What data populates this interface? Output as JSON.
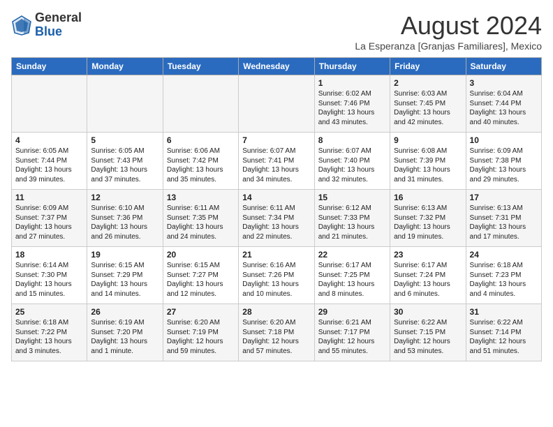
{
  "logo": {
    "line1": "General",
    "line2": "Blue"
  },
  "title": "August 2024",
  "location": "La Esperanza [Granjas Familiares], Mexico",
  "days_header": [
    "Sunday",
    "Monday",
    "Tuesday",
    "Wednesday",
    "Thursday",
    "Friday",
    "Saturday"
  ],
  "weeks": [
    [
      {
        "day": "",
        "content": ""
      },
      {
        "day": "",
        "content": ""
      },
      {
        "day": "",
        "content": ""
      },
      {
        "day": "",
        "content": ""
      },
      {
        "day": "1",
        "content": "Sunrise: 6:02 AM\nSunset: 7:46 PM\nDaylight: 13 hours\nand 43 minutes."
      },
      {
        "day": "2",
        "content": "Sunrise: 6:03 AM\nSunset: 7:45 PM\nDaylight: 13 hours\nand 42 minutes."
      },
      {
        "day": "3",
        "content": "Sunrise: 6:04 AM\nSunset: 7:44 PM\nDaylight: 13 hours\nand 40 minutes."
      }
    ],
    [
      {
        "day": "4",
        "content": "Sunrise: 6:05 AM\nSunset: 7:44 PM\nDaylight: 13 hours\nand 39 minutes."
      },
      {
        "day": "5",
        "content": "Sunrise: 6:05 AM\nSunset: 7:43 PM\nDaylight: 13 hours\nand 37 minutes."
      },
      {
        "day": "6",
        "content": "Sunrise: 6:06 AM\nSunset: 7:42 PM\nDaylight: 13 hours\nand 35 minutes."
      },
      {
        "day": "7",
        "content": "Sunrise: 6:07 AM\nSunset: 7:41 PM\nDaylight: 13 hours\nand 34 minutes."
      },
      {
        "day": "8",
        "content": "Sunrise: 6:07 AM\nSunset: 7:40 PM\nDaylight: 13 hours\nand 32 minutes."
      },
      {
        "day": "9",
        "content": "Sunrise: 6:08 AM\nSunset: 7:39 PM\nDaylight: 13 hours\nand 31 minutes."
      },
      {
        "day": "10",
        "content": "Sunrise: 6:09 AM\nSunset: 7:38 PM\nDaylight: 13 hours\nand 29 minutes."
      }
    ],
    [
      {
        "day": "11",
        "content": "Sunrise: 6:09 AM\nSunset: 7:37 PM\nDaylight: 13 hours\nand 27 minutes."
      },
      {
        "day": "12",
        "content": "Sunrise: 6:10 AM\nSunset: 7:36 PM\nDaylight: 13 hours\nand 26 minutes."
      },
      {
        "day": "13",
        "content": "Sunrise: 6:11 AM\nSunset: 7:35 PM\nDaylight: 13 hours\nand 24 minutes."
      },
      {
        "day": "14",
        "content": "Sunrise: 6:11 AM\nSunset: 7:34 PM\nDaylight: 13 hours\nand 22 minutes."
      },
      {
        "day": "15",
        "content": "Sunrise: 6:12 AM\nSunset: 7:33 PM\nDaylight: 13 hours\nand 21 minutes."
      },
      {
        "day": "16",
        "content": "Sunrise: 6:13 AM\nSunset: 7:32 PM\nDaylight: 13 hours\nand 19 minutes."
      },
      {
        "day": "17",
        "content": "Sunrise: 6:13 AM\nSunset: 7:31 PM\nDaylight: 13 hours\nand 17 minutes."
      }
    ],
    [
      {
        "day": "18",
        "content": "Sunrise: 6:14 AM\nSunset: 7:30 PM\nDaylight: 13 hours\nand 15 minutes."
      },
      {
        "day": "19",
        "content": "Sunrise: 6:15 AM\nSunset: 7:29 PM\nDaylight: 13 hours\nand 14 minutes."
      },
      {
        "day": "20",
        "content": "Sunrise: 6:15 AM\nSunset: 7:27 PM\nDaylight: 13 hours\nand 12 minutes."
      },
      {
        "day": "21",
        "content": "Sunrise: 6:16 AM\nSunset: 7:26 PM\nDaylight: 13 hours\nand 10 minutes."
      },
      {
        "day": "22",
        "content": "Sunrise: 6:17 AM\nSunset: 7:25 PM\nDaylight: 13 hours\nand 8 minutes."
      },
      {
        "day": "23",
        "content": "Sunrise: 6:17 AM\nSunset: 7:24 PM\nDaylight: 13 hours\nand 6 minutes."
      },
      {
        "day": "24",
        "content": "Sunrise: 6:18 AM\nSunset: 7:23 PM\nDaylight: 13 hours\nand 4 minutes."
      }
    ],
    [
      {
        "day": "25",
        "content": "Sunrise: 6:18 AM\nSunset: 7:22 PM\nDaylight: 13 hours\nand 3 minutes."
      },
      {
        "day": "26",
        "content": "Sunrise: 6:19 AM\nSunset: 7:20 PM\nDaylight: 13 hours\nand 1 minute."
      },
      {
        "day": "27",
        "content": "Sunrise: 6:20 AM\nSunset: 7:19 PM\nDaylight: 12 hours\nand 59 minutes."
      },
      {
        "day": "28",
        "content": "Sunrise: 6:20 AM\nSunset: 7:18 PM\nDaylight: 12 hours\nand 57 minutes."
      },
      {
        "day": "29",
        "content": "Sunrise: 6:21 AM\nSunset: 7:17 PM\nDaylight: 12 hours\nand 55 minutes."
      },
      {
        "day": "30",
        "content": "Sunrise: 6:22 AM\nSunset: 7:15 PM\nDaylight: 12 hours\nand 53 minutes."
      },
      {
        "day": "31",
        "content": "Sunrise: 6:22 AM\nSunset: 7:14 PM\nDaylight: 12 hours\nand 51 minutes."
      }
    ]
  ]
}
